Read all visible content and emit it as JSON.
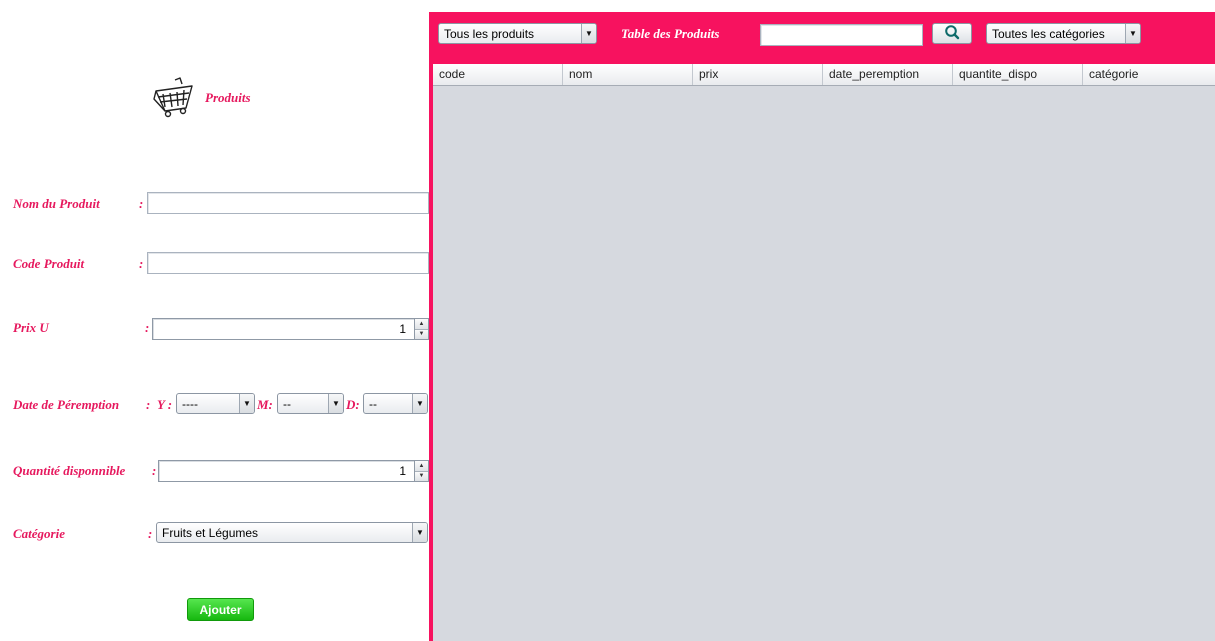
{
  "form": {
    "header_title": "Produits",
    "header_icon": "shopping-cart-icon",
    "name_label": "Nom du Produit",
    "name_value": "",
    "code_label": "Code Produit",
    "code_value": "",
    "price_label": "Prix U",
    "price_value": "1",
    "date_label": "Date de Péremption",
    "date_y_label": "Y :",
    "date_y_value": "----",
    "date_m_label": "M:",
    "date_m_value": "--",
    "date_d_label": "D:",
    "date_d_value": "--",
    "qty_label": "Quantité disponnible",
    "qty_value": "1",
    "category_label": "Catégorie",
    "category_value": "Fruits et Légumes",
    "colon": ":",
    "add_button": "Ajouter"
  },
  "table_panel": {
    "filter_value": "Tous les produits",
    "title": "Table des Produits",
    "search_value": "",
    "search_icon": "search-icon",
    "category_filter_value": "Toutes les catégories",
    "columns": [
      "code",
      "nom",
      "prix",
      "date_peremption",
      "quantite_dispo",
      "catégorie"
    ],
    "rows": []
  },
  "colors": {
    "accent": "#f7125f",
    "label": "#e6195e",
    "table_bg": "#d6d9df",
    "button_green": "#1fc41a"
  }
}
